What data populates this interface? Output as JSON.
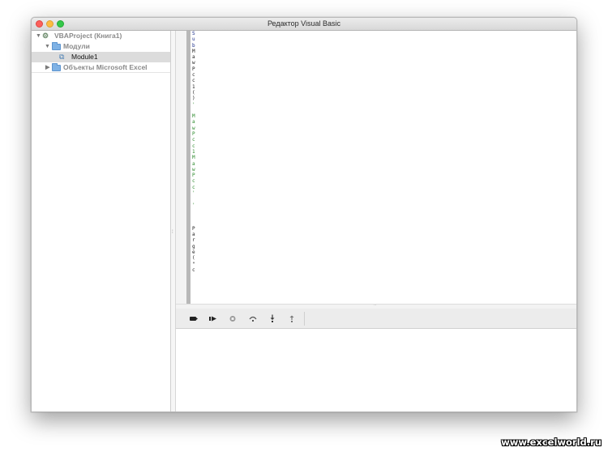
{
  "window": {
    "title": "Редактор Visual Basic"
  },
  "project_tree": {
    "project": "VBAProject (Книга1)",
    "modules_folder": "Модули",
    "module": "Module1",
    "objects_folder": "Объекты Microsoft Excel"
  },
  "code_gutter_chars": [
    {
      "ch": "S",
      "tone": "dark"
    },
    {
      "ch": "u",
      "tone": "dark"
    },
    {
      "ch": "b",
      "tone": "dark"
    },
    {
      "ch": "M",
      "tone": "black"
    },
    {
      "ch": "a",
      "tone": "black"
    },
    {
      "ch": "w",
      "tone": "black"
    },
    {
      "ch": "P",
      "tone": "black"
    },
    {
      "ch": "c",
      "tone": "black"
    },
    {
      "ch": "c",
      "tone": "black"
    },
    {
      "ch": "1",
      "tone": "black"
    },
    {
      "ch": "(",
      "tone": "black"
    },
    {
      "ch": ")",
      "tone": "black"
    },
    {
      "ch": "'",
      "tone": "green"
    },
    {
      "ch": "",
      "tone": "black"
    },
    {
      "ch": "M",
      "tone": "green"
    },
    {
      "ch": "a",
      "tone": "green"
    },
    {
      "ch": "w",
      "tone": "green"
    },
    {
      "ch": "P",
      "tone": "green"
    },
    {
      "ch": "c",
      "tone": "green"
    },
    {
      "ch": "c",
      "tone": "green"
    },
    {
      "ch": "1",
      "tone": "green"
    },
    {
      "ch": "M",
      "tone": "green"
    },
    {
      "ch": "a",
      "tone": "green"
    },
    {
      "ch": "w",
      "tone": "green"
    },
    {
      "ch": "P",
      "tone": "green"
    },
    {
      "ch": "c",
      "tone": "green"
    },
    {
      "ch": "c",
      "tone": "green"
    },
    {
      "ch": "'",
      "tone": "green"
    },
    {
      "ch": "",
      "tone": "black"
    },
    {
      "ch": "'",
      "tone": "green"
    },
    {
      "ch": "",
      "tone": "black"
    },
    {
      "ch": "",
      "tone": "black"
    },
    {
      "ch": "",
      "tone": "black"
    },
    {
      "ch": "P",
      "tone": "black"
    },
    {
      "ch": "a",
      "tone": "black"
    },
    {
      "ch": "r",
      "tone": "black"
    },
    {
      "ch": "g",
      "tone": "black"
    },
    {
      "ch": "e",
      "tone": "black"
    },
    {
      "ch": "(",
      "tone": "black"
    },
    {
      "ch": "\"",
      "tone": "black"
    },
    {
      "ch": "c",
      "tone": "black"
    }
  ],
  "toolbar": {
    "buttons": [
      "record-icon",
      "run-icon",
      "stop-icon",
      "step-over-icon",
      "step-into-icon",
      "step-out-icon"
    ]
  },
  "watermark": "www.excelworld.ru"
}
